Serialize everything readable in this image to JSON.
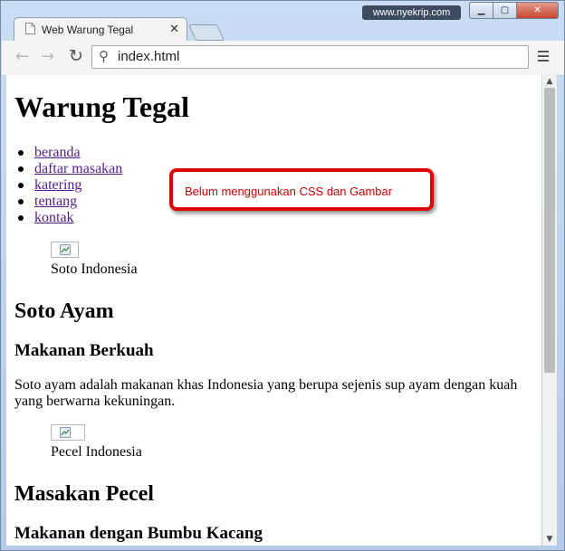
{
  "browser": {
    "tab_title": "Web Warung Tegal",
    "tab_close": "✕",
    "watermark": "www.nyekrip.com",
    "url": "index.html"
  },
  "page": {
    "title": "Warung Tegal",
    "nav": [
      "beranda",
      "daftar masakan",
      "katering",
      "tentang",
      "kontak"
    ],
    "sections": [
      {
        "caption": "Soto Indonesia",
        "heading": "Soto Ayam",
        "subheading": "Makanan Berkuah",
        "paragraph": "Soto ayam adalah makanan khas Indonesia yang berupa sejenis sup ayam dengan kuah yang berwarna kekuningan."
      },
      {
        "caption": "Pecel Indonesia",
        "heading": "Masakan Pecel",
        "subheading": "Makanan dengan Bumbu Kacang"
      }
    ]
  },
  "annotation": "Belum menggunakan CSS dan Gambar",
  "colors": {
    "link": "#551a8b",
    "annotation_border": "#e00000",
    "annotation_text": "#d00000"
  }
}
